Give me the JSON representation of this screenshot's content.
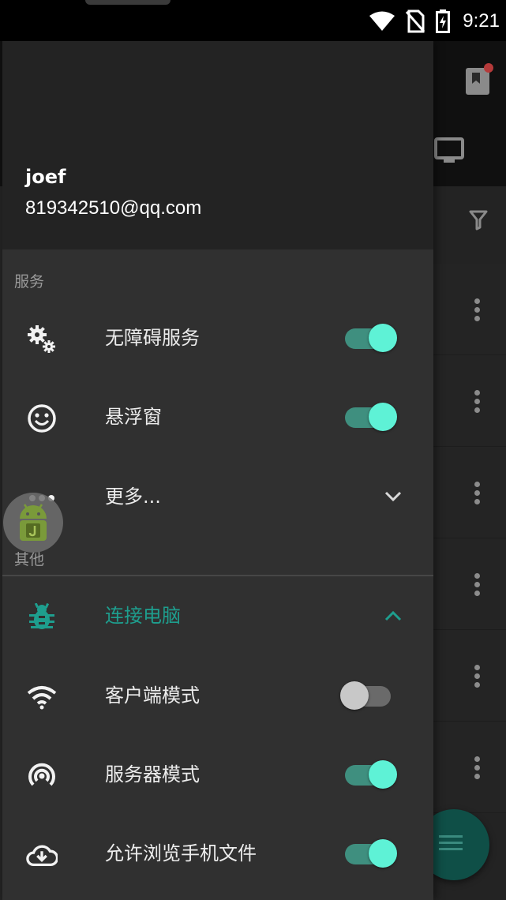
{
  "status_bar": {
    "time": "9:21"
  },
  "drawer": {
    "user": {
      "name": "joef",
      "email": "819342510@qq.com"
    },
    "sections": {
      "services": {
        "title": "服务",
        "items": [
          {
            "label": "无障碍服务",
            "icon": "gears-icon",
            "switch_on": true
          },
          {
            "label": "悬浮窗",
            "icon": "smiley-icon",
            "switch_on": true
          },
          {
            "label": "更多...",
            "icon": "more-dots-icon",
            "chevron": "down"
          }
        ]
      },
      "other": {
        "title": "其他",
        "items": [
          {
            "label": "连接电脑",
            "icon": "bug-icon",
            "chevron": "up",
            "accent": true
          },
          {
            "label": "客户端模式",
            "icon": "wifi-icon",
            "switch_on": false
          },
          {
            "label": "服务器模式",
            "icon": "hotspot-icon",
            "switch_on": true
          },
          {
            "label": "允许浏览手机文件",
            "icon": "cloud-download-icon",
            "switch_on": true
          }
        ]
      }
    }
  },
  "colors": {
    "accent": "#1e9e8e",
    "switch_thumb_on": "#5ef2d6",
    "switch_track_on": "#3f8f7f",
    "drawer_bg": "#303030"
  }
}
